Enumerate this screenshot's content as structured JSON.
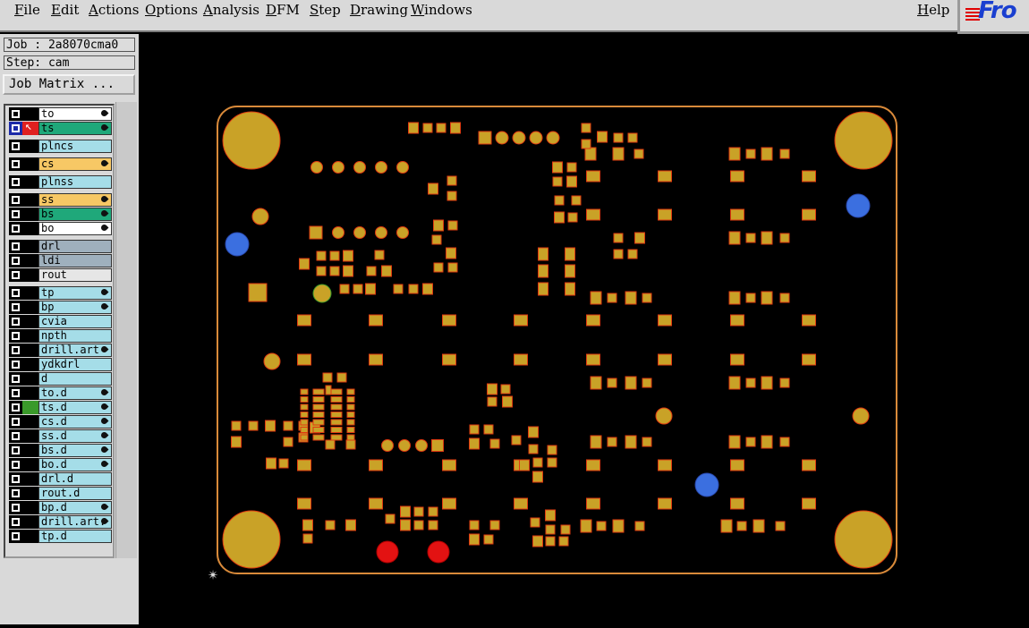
{
  "menu": [
    "File",
    "Edit",
    "Actions",
    "Options",
    "Analysis",
    "DFM",
    "Step",
    "Drawing",
    "Windows"
  ],
  "help_label": "Help",
  "logo_text": "Fro",
  "job_label": "Job : 2a8070cma0",
  "step_label": "Step: cam",
  "job_matrix_label": "Job Matrix ...",
  "colors": {
    "panel": "#d9d9d9",
    "board_outline": "#d98a3a",
    "copper": "#c9a227",
    "pad_edge": "#e03a10",
    "via_blue": "#3b6fe0",
    "drill_red": "#e31212",
    "layer_yellow": "#f7c865",
    "layer_green": "#1fa87a",
    "layer_cyan": "#a5dde8",
    "layer_gray": "#9fb0bd"
  },
  "layers": [
    {
      "name": "to",
      "color": "#ffffff",
      "arrow": true
    },
    {
      "name": "ts",
      "color": "#1fa87a",
      "arrow": true,
      "active": true
    },
    {
      "name": "plncs",
      "color": "#a5dde8",
      "arrow": false,
      "gap": true
    },
    {
      "name": "cs",
      "color": "#f7c865",
      "arrow": true,
      "gap": true
    },
    {
      "name": "plnss",
      "color": "#a5dde8",
      "arrow": false,
      "gap": true
    },
    {
      "name": "ss",
      "color": "#f7c865",
      "arrow": true,
      "gap": true
    },
    {
      "name": "bs",
      "color": "#1fa87a",
      "arrow": true
    },
    {
      "name": "bo",
      "color": "#ffffff",
      "arrow": true
    },
    {
      "name": "drl",
      "color": "#9fb0bd",
      "arrow": false,
      "gap": true
    },
    {
      "name": "ldi",
      "color": "#9fb0bd",
      "arrow": false
    },
    {
      "name": "rout",
      "color": "#e6e6e6",
      "arrow": false
    },
    {
      "name": "tp",
      "color": "#a5dde8",
      "arrow": true,
      "gap": true
    },
    {
      "name": "bp",
      "color": "#a5dde8",
      "arrow": true
    },
    {
      "name": "cvia",
      "color": "#a5dde8",
      "arrow": false
    },
    {
      "name": "npth",
      "color": "#a5dde8",
      "arrow": false
    },
    {
      "name": "drill.art",
      "color": "#a5dde8",
      "arrow": true
    },
    {
      "name": "ydkdrl",
      "color": "#a5dde8",
      "arrow": false
    },
    {
      "name": "d",
      "color": "#a5dde8",
      "arrow": false
    },
    {
      "name": "to.d",
      "color": "#a5dde8",
      "arrow": true
    },
    {
      "name": "ts.d",
      "color": "#a5dde8",
      "arrow": true,
      "greenmark": true
    },
    {
      "name": "cs.d",
      "color": "#a5dde8",
      "arrow": true
    },
    {
      "name": "ss.d",
      "color": "#a5dde8",
      "arrow": true
    },
    {
      "name": "bs.d",
      "color": "#a5dde8",
      "arrow": true
    },
    {
      "name": "bo.d",
      "color": "#a5dde8",
      "arrow": true
    },
    {
      "name": "drl.d",
      "color": "#a5dde8",
      "arrow": false
    },
    {
      "name": "rout.d",
      "color": "#a5dde8",
      "arrow": false
    },
    {
      "name": "bp.d",
      "color": "#a5dde8",
      "arrow": true
    },
    {
      "name": "drill.art.",
      "color": "#a5dde8",
      "arrow": true
    },
    {
      "name": "tp.d",
      "color": "#a5dde8",
      "arrow": false
    }
  ]
}
